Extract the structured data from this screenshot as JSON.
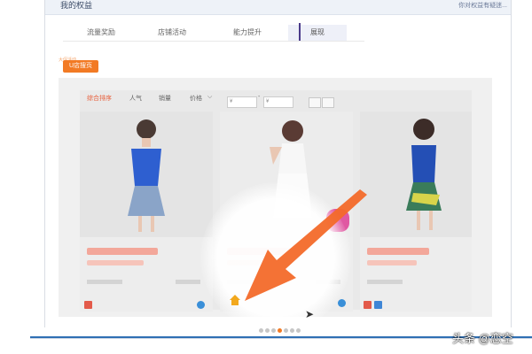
{
  "header": {
    "title": "我的权益",
    "link": "你对权益有疑迷..."
  },
  "tabs": [
    "流量奖励",
    "店铺活动",
    "能力提升",
    "展现"
  ],
  "button": {
    "label": "U店搜页"
  },
  "tiny_label": "大促活动",
  "sort": {
    "items": [
      "综合排序",
      "人气",
      "销量",
      "价格"
    ],
    "price_from": "¥",
    "price_to": "¥"
  },
  "pager": {
    "dots": 7,
    "active_index": 3
  },
  "watermark": "头条 @恋空",
  "colors": {
    "accent": "#f27a24",
    "tab_marker": "#4b3b8a",
    "bottom_bar": "#2f6fb3"
  }
}
